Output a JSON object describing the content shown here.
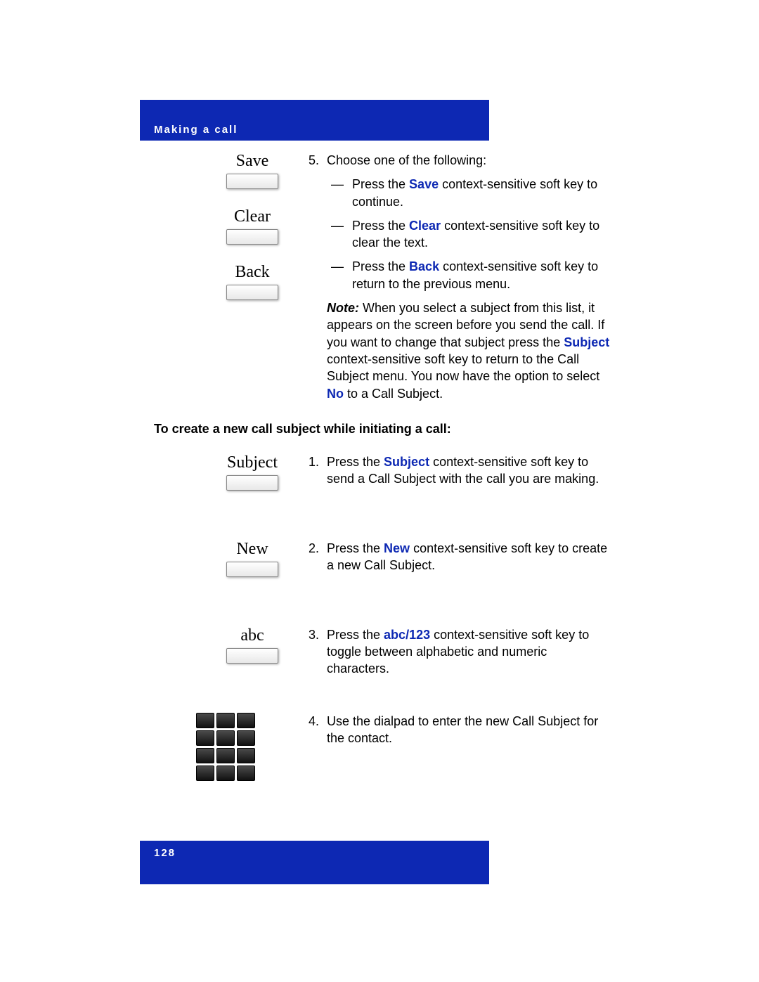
{
  "header": {
    "title": "Making a call"
  },
  "softkeys": {
    "save": "Save",
    "clear": "Clear",
    "back": "Back",
    "subject": "Subject",
    "new": "New",
    "abc": "abc"
  },
  "step5": {
    "num": "5.",
    "lead": "Choose one of the following:",
    "opts": {
      "save": {
        "pre": "Press the ",
        "kw": "Save",
        "post": " context-sensitive soft key to continue."
      },
      "clear": {
        "pre": "Press the ",
        "kw": "Clear",
        "post": " context-sensitive soft key to clear the text."
      },
      "back": {
        "pre": "Press the ",
        "kw": "Back",
        "post": " context-sensitive soft key to return to the previous menu."
      }
    }
  },
  "note": {
    "label": "Note:",
    "t1": "  When you select a subject from this list, it appears on the screen before you send the call. If you want to change that subject press the ",
    "kw1": "Subject",
    "t2": " context-sensitive soft key to return to the Call Subject menu. You now have the option to select ",
    "kw2": "No",
    "t3": " to a Call Subject."
  },
  "heading2": "To create a new call subject while initiating a call:",
  "steps2": {
    "s1": {
      "num": "1.",
      "pre": "Press the ",
      "kw": "Subject",
      "post": " context-sensitive soft key to send a Call Subject with the call you are making."
    },
    "s2": {
      "num": "2.",
      "pre": "Press the ",
      "kw": "New",
      "post": " context-sensitive soft key to create a new Call Subject."
    },
    "s3": {
      "num": "3.",
      "pre": "Press the ",
      "kw": "abc/123",
      "post": " context-sensitive soft key to toggle between alphabetic and numeric characters."
    },
    "s4": {
      "num": "4.",
      "text": "Use the dialpad to enter the new Call Subject for the contact."
    }
  },
  "footer": {
    "page": "128"
  }
}
